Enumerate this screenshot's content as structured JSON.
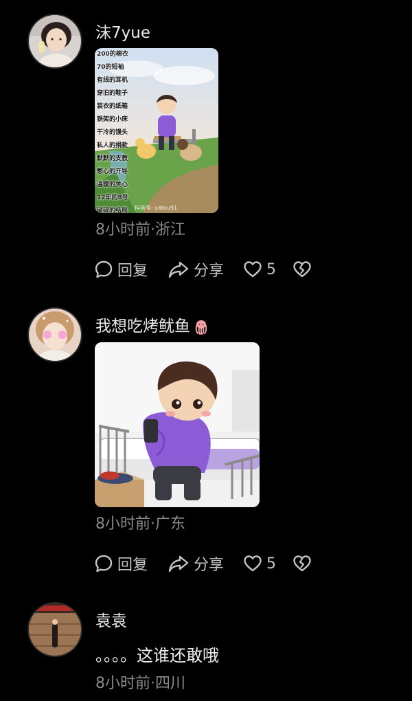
{
  "comments": [
    {
      "username": "沫7yue",
      "time_location": "8小时前·浙江",
      "reply_label": "回复",
      "share_label": "分享",
      "like_count": "5",
      "image_text_lines": [
        "200的棉衣",
        "70的短袖",
        "有线的耳机",
        "穿旧的鞋子",
        "装衣的纸箱",
        "铁架的小床",
        "干冷的馒头",
        "私人的捐款",
        "默默的支教",
        "憋心的开导",
        "温暖的关心",
        "12年的8号",
        "破碎的结局"
      ],
      "image_watermark": "抖音号: yatou91"
    },
    {
      "username": "我想吃烤鱿鱼",
      "time_location": "8小时前·广东",
      "reply_label": "回复",
      "share_label": "分享",
      "like_count": "5"
    },
    {
      "username": "袁袁",
      "text": "。。。。这谁还敢哦",
      "time_location": "8小时前·四川"
    }
  ],
  "icons": {
    "reply": "speech-bubble-icon",
    "share": "share-arrow-icon",
    "like": "heart-outline-icon",
    "dislike": "broken-heart-icon",
    "username_emoji": "squid-emoji-icon"
  },
  "colors": {
    "background": "#000000",
    "username": "#e9e9e9",
    "meta": "#8a8a8a",
    "action": "#c4c4c4",
    "hoodie_purple": "#8b5cd6"
  }
}
